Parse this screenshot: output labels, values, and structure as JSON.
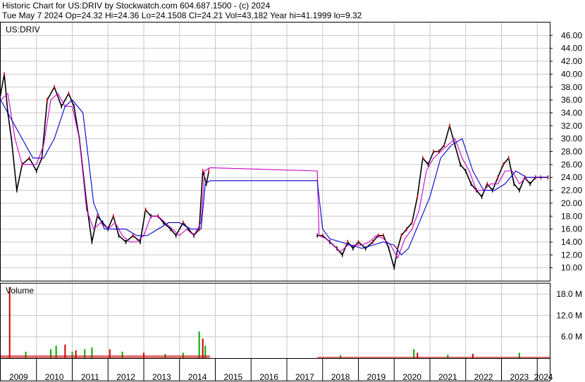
{
  "header": {
    "line1": "Historic Chart for US:DRIV by Stockwatch.com 604.687.1500 - (c) 2024",
    "line2": "Tue May  7 2024   Op=24.32  Hi=24.36  Lo=24.1508  Cl=24.21  Vol=43,182  Year hi=41.1999  lo=9.32"
  },
  "symbol_label": "US:DRIV",
  "volume_label": "Volume",
  "chart_data": [
    {
      "type": "line",
      "title": "US:DRIV",
      "x_ticks": [
        "2009",
        "2010",
        "2011",
        "2012",
        "2013",
        "2014",
        "2015",
        "2016",
        "2017",
        "2018",
        "2019",
        "2020",
        "2021",
        "2022",
        "2023",
        "2024"
      ],
      "y_ticks": [
        "10.00",
        "12.00",
        "14.00",
        "16.00",
        "18.00",
        "20.00",
        "22.00",
        "24.00",
        "26.00",
        "28.00",
        "30.00",
        "32.00",
        "34.00",
        "36.00",
        "38.00",
        "40.00",
        "42.00",
        "44.00",
        "46.00"
      ],
      "ylim": [
        8,
        48
      ],
      "grid": true,
      "colors": {
        "price": "#000000",
        "up": "#cc0000",
        "ma_short": "#cc00cc",
        "ma_long": "#0000cc"
      },
      "series": [
        {
          "name": "",
          "role": "price",
          "x": [
            2009.0,
            2009.1,
            2009.2,
            2009.3,
            2009.45,
            2009.6,
            2009.8,
            2010.0,
            2010.15,
            2010.3,
            2010.5,
            2010.7,
            2010.9,
            2011.05,
            2011.2,
            2011.4,
            2011.55,
            2011.7,
            2011.85,
            2012.0,
            2012.15,
            2012.3,
            2012.5,
            2012.7,
            2012.9,
            2013.05,
            2013.2,
            2013.4,
            2013.55,
            2013.75,
            2013.9,
            2014.1,
            2014.25,
            2014.4,
            2014.55,
            2014.65,
            2014.75,
            2014.82
          ],
          "values": [
            37,
            40,
            34,
            30,
            22,
            26,
            27,
            25,
            27,
            36,
            38,
            35,
            37,
            35,
            30,
            20,
            14,
            18,
            17,
            16,
            18,
            15,
            14,
            15,
            14,
            19,
            18,
            18,
            17,
            16,
            15,
            17,
            16,
            15,
            16,
            25,
            23,
            25
          ]
        },
        {
          "name": "",
          "role": "price",
          "x": [
            2017.85,
            2018.0,
            2018.2,
            2018.4,
            2018.55,
            2018.7,
            2018.85,
            2019.0,
            2019.2,
            2019.4,
            2019.55,
            2019.7,
            2019.85,
            2020.0,
            2020.1,
            2020.2,
            2020.35,
            2020.5,
            2020.65,
            2020.8,
            2020.95,
            2021.1,
            2021.25,
            2021.4,
            2021.55,
            2021.7,
            2021.85,
            2022.0,
            2022.15,
            2022.3,
            2022.45,
            2022.6,
            2022.75,
            2022.9,
            2023.05,
            2023.2,
            2023.35,
            2023.5,
            2023.65,
            2023.8,
            2023.95,
            2024.1,
            2024.3
          ],
          "values": [
            15,
            15,
            14,
            13,
            12,
            14,
            13,
            14,
            13,
            14,
            15,
            15,
            13,
            10,
            13,
            15,
            16,
            17,
            21,
            27,
            26,
            28,
            28,
            29,
            32,
            29,
            26,
            25,
            23,
            22,
            21,
            23,
            22,
            24,
            26,
            27,
            23,
            22,
            24,
            23,
            24,
            24,
            24
          ]
        },
        {
          "name": "",
          "role": "ma_short",
          "x": [
            2009.0,
            2009.2,
            2009.4,
            2009.6,
            2009.8,
            2010.0,
            2010.2,
            2010.4,
            2010.6,
            2010.8,
            2011.0,
            2011.2,
            2011.4,
            2011.6,
            2011.8,
            2012.0,
            2012.2,
            2012.4,
            2012.6,
            2012.8,
            2013.0,
            2013.2,
            2013.4,
            2013.6,
            2013.8,
            2014.0,
            2014.2,
            2014.4,
            2014.6,
            2014.7,
            2014.85,
            2017.85,
            2017.9,
            2018.1,
            2018.3,
            2018.5,
            2018.7,
            2018.9,
            2019.1,
            2019.3,
            2019.5,
            2019.7,
            2019.9,
            2020.1,
            2020.3,
            2020.5,
            2020.7,
            2020.9,
            2021.1,
            2021.3,
            2021.5,
            2021.7,
            2021.9,
            2022.1,
            2022.3,
            2022.5,
            2022.7,
            2022.9,
            2023.1,
            2023.3,
            2023.5,
            2023.7,
            2023.9,
            2024.1,
            2024.3
          ],
          "values": [
            36,
            37,
            30,
            26,
            26,
            26,
            29,
            36,
            37,
            35,
            35,
            30,
            19,
            16,
            17,
            16,
            17,
            15,
            14,
            14,
            15,
            18,
            18,
            17,
            16,
            15,
            16,
            15,
            17,
            25,
            25.5,
            25,
            15,
            14.5,
            13.5,
            12.5,
            13.5,
            13.5,
            13.5,
            14,
            15,
            14.5,
            13.5,
            11.5,
            14.5,
            16,
            19,
            25,
            27,
            28,
            29,
            30,
            27,
            25,
            22,
            22,
            23,
            23,
            25,
            25,
            23,
            24,
            24,
            24,
            24
          ]
        },
        {
          "name": "",
          "role": "ma_long",
          "x": [
            2009.0,
            2009.3,
            2009.6,
            2009.9,
            2010.2,
            2010.5,
            2010.8,
            2011.0,
            2011.3,
            2011.6,
            2011.9,
            2012.2,
            2012.5,
            2012.8,
            2013.1,
            2013.4,
            2013.7,
            2014.0,
            2014.3,
            2014.6,
            2014.72,
            2014.85,
            2017.85,
            2018.0,
            2018.2,
            2018.5,
            2018.8,
            2019.1,
            2019.4,
            2019.7,
            2020.0,
            2020.2,
            2020.4,
            2020.7,
            2021.0,
            2021.3,
            2021.6,
            2021.9,
            2022.2,
            2022.5,
            2022.8,
            2023.1,
            2023.4,
            2023.7,
            2024.0,
            2024.3
          ],
          "values": [
            36,
            33,
            30,
            27,
            27,
            30,
            35,
            36,
            34,
            20,
            16,
            16,
            16,
            15,
            15,
            16,
            17,
            17,
            16,
            16,
            23,
            23.5,
            23.5,
            16,
            14.5,
            14,
            13.5,
            13,
            13.5,
            14,
            13.5,
            12,
            13,
            17,
            21,
            27,
            29,
            30,
            25,
            22,
            22,
            23,
            25,
            24,
            24,
            24
          ]
        }
      ]
    },
    {
      "type": "bar",
      "title": "Volume",
      "y_ticks": [
        "6.0 M",
        "12.0 M",
        "18.0 M"
      ],
      "ylim": [
        0,
        21
      ],
      "unit": "M",
      "colors": {
        "up": "#00aa00",
        "down": "#cc0000"
      },
      "series": [
        {
          "name": "",
          "role": "volume",
          "x": [
            2009.25,
            2009.7,
            2010.4,
            2010.55,
            2010.8,
            2011.0,
            2011.1,
            2011.35,
            2011.55,
            2012.05,
            2012.4,
            2013.0,
            2013.6,
            2014.1,
            2014.55,
            2014.65,
            2014.72,
            2018.5,
            2020.55,
            2020.65,
            2021.5,
            2022.2,
            2023.5
          ],
          "values": [
            20,
            1.8,
            2.5,
            3.5,
            3.8,
            1.8,
            2.2,
            2.5,
            3,
            2.5,
            1.8,
            1.5,
            1.2,
            1.5,
            7.5,
            5.5,
            3.5,
            0.8,
            2.5,
            1.5,
            1,
            1.2,
            1.5
          ],
          "up": [
            false,
            true,
            true,
            true,
            false,
            true,
            false,
            true,
            true,
            false,
            true,
            false,
            true,
            true,
            true,
            false,
            true,
            true,
            true,
            false,
            true,
            false,
            true
          ]
        }
      ]
    }
  ]
}
